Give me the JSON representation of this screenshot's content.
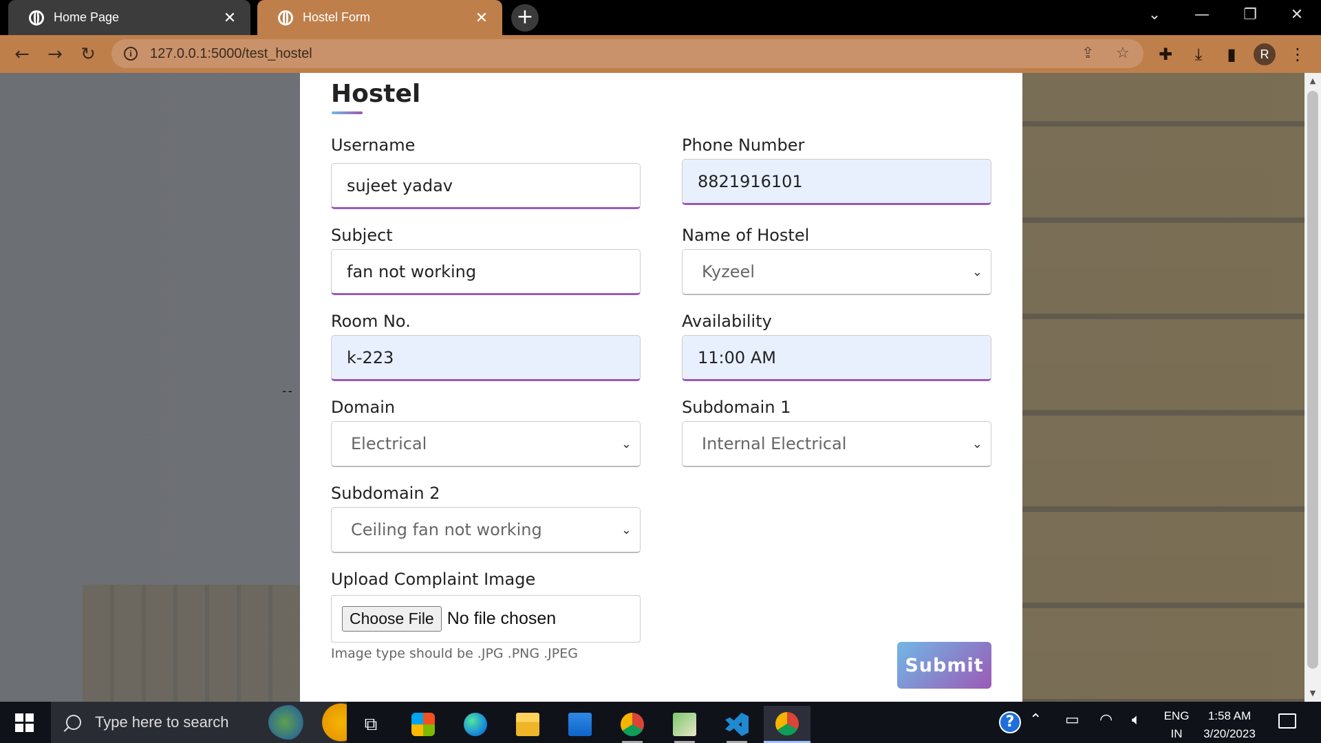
{
  "browser": {
    "tabs": [
      {
        "title": "Home Page",
        "icon": "globe-icon",
        "active": false
      },
      {
        "title": "Hostel Form",
        "icon": "globe-icon",
        "active": true
      }
    ],
    "close_glyph": "✕",
    "new_tab_glyph": "+",
    "url": "127.0.0.1:5000/test_hostel",
    "profile_initial": "R",
    "accent_color": "#bf7f4b"
  },
  "form": {
    "title": "Hostel",
    "fields": {
      "username": {
        "label": "Username",
        "value": "sujeet yadav"
      },
      "phone": {
        "label": "Phone Number",
        "value": "8821916101"
      },
      "subject": {
        "label": "Subject",
        "value": "fan not working"
      },
      "hostel": {
        "label": "Name of Hostel",
        "value": "Kyzeel"
      },
      "room": {
        "label": "Room No.",
        "value": "k-223"
      },
      "availability": {
        "label": "Availability",
        "value": "11:00 AM"
      },
      "domain": {
        "label": "Domain",
        "value": "Electrical"
      },
      "subdomain1": {
        "label": "Subdomain 1",
        "value": "Internal Electrical"
      },
      "subdomain2": {
        "label": "Subdomain 2",
        "value": "Ceiling fan not working"
      },
      "upload": {
        "label": "Upload Complaint Image",
        "button": "Choose File",
        "status": "No file chosen",
        "hint": "Image type should be .JPG .PNG .JPEG"
      }
    },
    "submit_label": "Submit",
    "gradient_colors": [
      "#71b7e6",
      "#9b59b6"
    ]
  },
  "taskbar": {
    "search_placeholder": "Type here to search",
    "apps": [
      "task-view-icon",
      "microsoft-store-icon",
      "edge-icon",
      "file-explorer-icon",
      "mail-icon",
      "chrome-icon",
      "image-viewer-icon",
      "vscode-icon",
      "chrome-profile-icon"
    ],
    "language_line1": "ENG",
    "language_line2": "IN",
    "time": "1:58 AM",
    "date": "3/20/2023"
  }
}
